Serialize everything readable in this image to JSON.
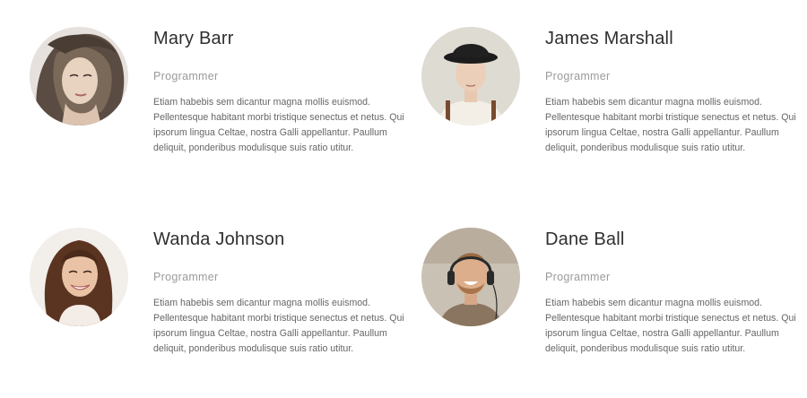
{
  "team": [
    {
      "name": "Mary Barr",
      "role": "Programmer",
      "bio": "Etiam habebis sem dicantur magna mollis euismod. Pellentesque habitant morbi tristique senectus et netus. Qui ipsorum lingua Celtae, nostra Galli appellantur. Paullum deliquit, ponderibus modulisque suis ratio utitur."
    },
    {
      "name": "James Marshall",
      "role": "Programmer",
      "bio": "Etiam habebis sem dicantur magna mollis euismod. Pellentesque habitant morbi tristique senectus et netus. Qui ipsorum lingua Celtae, nostra Galli appellantur. Paullum deliquit, ponderibus modulisque suis ratio utitur."
    },
    {
      "name": "Wanda Johnson",
      "role": "Programmer",
      "bio": "Etiam habebis sem dicantur magna mollis euismod. Pellentesque habitant morbi tristique senectus et netus. Qui ipsorum lingua Celtae, nostra Galli appellantur. Paullum deliquit, ponderibus modulisque suis ratio utitur."
    },
    {
      "name": "Dane Ball",
      "role": "Programmer",
      "bio": "Etiam habebis sem dicantur magna mollis euismod. Pellentesque habitant morbi tristique senectus et netus. Qui ipsorum lingua Celtae, nostra Galli appellantur. Paullum deliquit, ponderibus modulisque suis ratio utitur."
    }
  ]
}
